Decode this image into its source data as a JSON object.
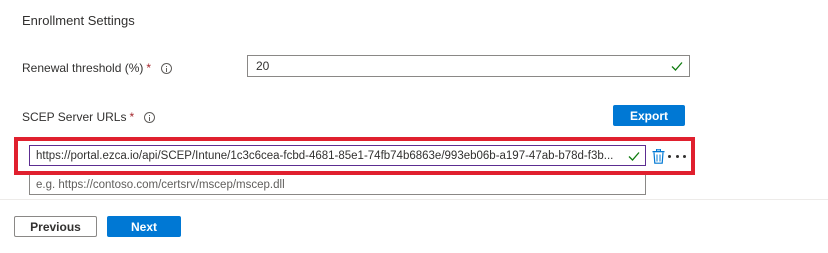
{
  "section": {
    "title": "Enrollment Settings"
  },
  "renewal": {
    "label": "Renewal threshold (%)",
    "required_mark": "*",
    "value": "20",
    "valid_icon": "checkmark-icon"
  },
  "scep": {
    "label": "SCEP Server URLs",
    "required_mark": "*",
    "export_label": "Export",
    "url_value": "https://portal.ezca.io/api/SCEP/Intune/1c3c6cea-fcbd-4681-85e1-74fb74b6863e/993eb06b-a197-47ab-b78d-f3b...",
    "new_url_placeholder": "e.g. https://contoso.com/certsrv/mscep/mscep.dll",
    "row_actions": [
      "trash-icon",
      "more-icon"
    ]
  },
  "footer": {
    "previous_label": "Previous",
    "next_label": "Next"
  },
  "colors": {
    "primary": "#0078d4",
    "required": "#a4262c",
    "valid": "#107c10",
    "highlight": "#e0202e"
  }
}
